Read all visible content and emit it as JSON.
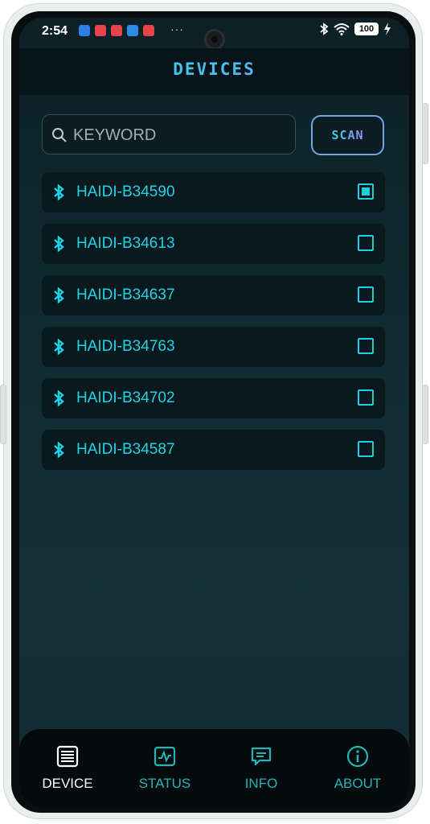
{
  "status_bar": {
    "time": "2:54",
    "more": "···",
    "battery": "100",
    "notification_icons": [
      "mail-icon",
      "app-icon",
      "app-icon",
      "shield-app-icon",
      "app-icon"
    ],
    "right_icons": [
      "bluetooth-icon",
      "wifi-icon",
      "battery-icon",
      "charging-icon"
    ]
  },
  "header": {
    "title": "DEVICES"
  },
  "search": {
    "placeholder": "KEYWORD",
    "value": ""
  },
  "scan_button": {
    "label": "SCAN"
  },
  "devices": [
    {
      "name": "HAIDI-B34590",
      "checked": true
    },
    {
      "name": "HAIDI-B34613",
      "checked": false
    },
    {
      "name": "HAIDI-B34637",
      "checked": false
    },
    {
      "name": "HAIDI-B34763",
      "checked": false
    },
    {
      "name": "HAIDI-B34702",
      "checked": false
    },
    {
      "name": "HAIDI-B34587",
      "checked": false
    }
  ],
  "bottom_nav": [
    {
      "label": "DEVICE",
      "icon": "device-list-icon",
      "active": true
    },
    {
      "label": "STATUS",
      "icon": "status-chart-icon",
      "active": false
    },
    {
      "label": "INFO",
      "icon": "info-message-icon",
      "active": false
    },
    {
      "label": "ABOUT",
      "icon": "about-info-icon",
      "active": false
    }
  ],
  "colors": {
    "accent_cyan": "#1ed3e3",
    "accent_purple": "#9a8bf0",
    "nav_inactive": "#22b4b8",
    "background": "#0f2a31"
  }
}
